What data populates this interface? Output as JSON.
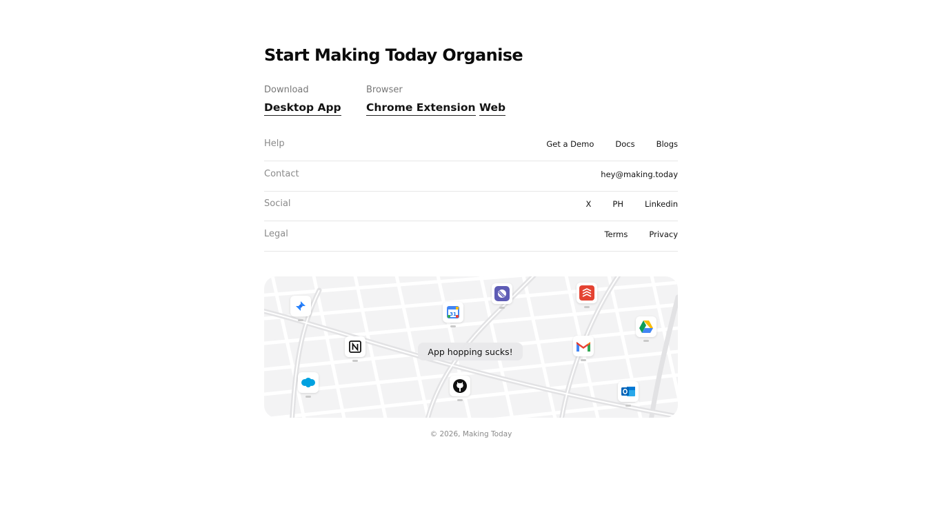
{
  "heading": "Start Making Today Organise",
  "download": {
    "label": "Download",
    "desktop_app": "Desktop App"
  },
  "browser": {
    "label": "Browser",
    "chrome_extension": "Chrome Extension",
    "web": "Web"
  },
  "rows": {
    "help": {
      "label": "Help",
      "links": [
        "Get a Demo",
        "Docs",
        "Blogs"
      ]
    },
    "contact": {
      "label": "Contact",
      "links": [
        "hey@making.today"
      ]
    },
    "social": {
      "label": "Social",
      "links": [
        "X",
        "PH",
        "Linkedin"
      ]
    },
    "legal": {
      "label": "Legal",
      "links": [
        "Terms",
        "Privacy"
      ]
    }
  },
  "map": {
    "center_label": "App hopping sucks!",
    "apps": [
      "jira-icon",
      "google-calendar-icon",
      "linear-icon",
      "todoist-icon",
      "google-drive-icon",
      "notion-icon",
      "gmail-icon",
      "salesforce-icon",
      "github-icon",
      "outlook-icon"
    ]
  },
  "footer": {
    "copyright": "© 2026, Making Today"
  }
}
